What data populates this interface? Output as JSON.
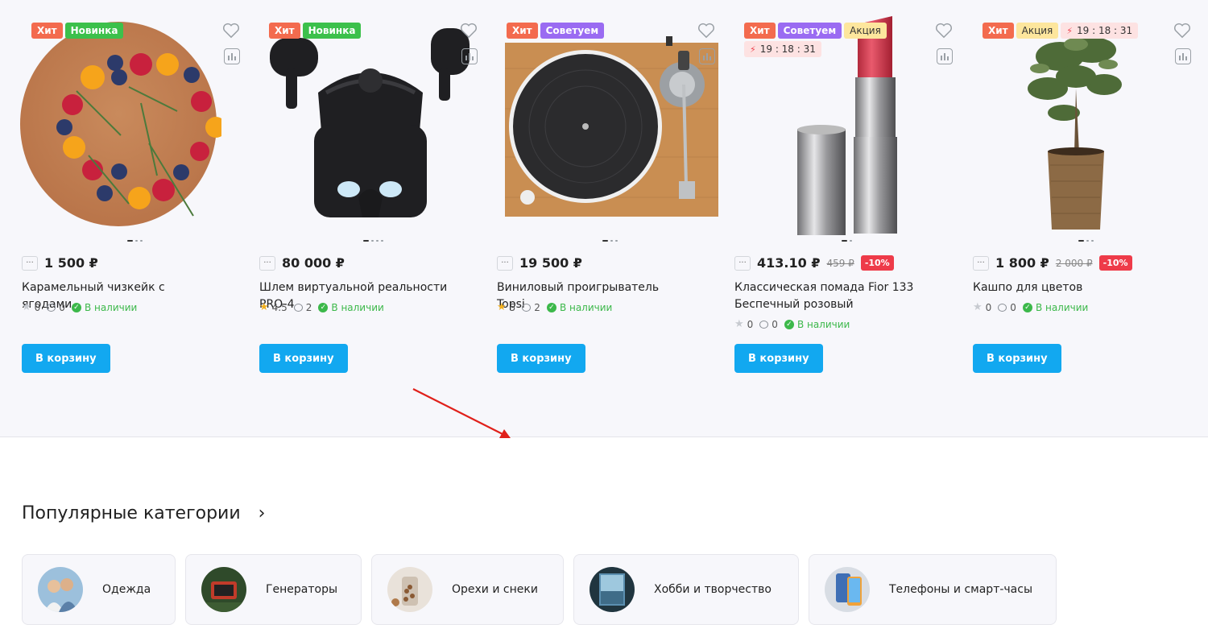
{
  "products": [
    {
      "badges": [
        {
          "type": "hit",
          "text": "Хит"
        },
        {
          "type": "new",
          "text": "Новинка"
        }
      ],
      "price": "1 500 ₽",
      "old_price": "",
      "discount": "",
      "name": "Карамельный чизкейк с ягодами",
      "rating": "0",
      "rated": false,
      "reviews": "0",
      "stock": "В наличии",
      "button": "В корзину",
      "image_icon": "cheesecake-image"
    },
    {
      "badges": [
        {
          "type": "hit",
          "text": "Хит"
        },
        {
          "type": "new",
          "text": "Новинка"
        }
      ],
      "price": "80 000 ₽",
      "old_price": "",
      "discount": "",
      "name": "Шлем виртуальной реальности PRO-4",
      "rating": "4.5",
      "rated": true,
      "reviews": "2",
      "stock": "В наличии",
      "button": "В корзину",
      "image_icon": "vr-headset-image"
    },
    {
      "badges": [
        {
          "type": "hit",
          "text": "Хит"
        },
        {
          "type": "rec",
          "text": "Советуем"
        }
      ],
      "price": "19 500 ₽",
      "old_price": "",
      "discount": "",
      "name": "Виниловый проигрыватель Topsi",
      "rating": "5",
      "rated": true,
      "reviews": "2",
      "stock": "В наличии",
      "button": "В корзину",
      "image_icon": "turntable-image"
    },
    {
      "badges": [
        {
          "type": "hit",
          "text": "Хит"
        },
        {
          "type": "rec",
          "text": "Советуем"
        },
        {
          "type": "promo",
          "text": "Акция"
        },
        {
          "type": "timer",
          "text": "19 : 18 : 31"
        }
      ],
      "price": "413.10 ₽",
      "old_price": "459 ₽",
      "discount": "-10%",
      "name": "Классическая помада Fior 133 Беспечный розовый",
      "rating": "0",
      "rated": false,
      "reviews": "0",
      "stock": "В наличии",
      "button": "В корзину",
      "image_icon": "lipstick-image"
    },
    {
      "badges": [
        {
          "type": "hit",
          "text": "Хит"
        },
        {
          "type": "promo",
          "text": "Акция"
        },
        {
          "type": "timer",
          "text": "19 : 18 : 31"
        }
      ],
      "price": "1 800 ₽",
      "old_price": "2 000 ₽",
      "discount": "-10%",
      "name": "Кашпо для цветов",
      "rating": "0",
      "rated": false,
      "reviews": "0",
      "stock": "В наличии",
      "button": "В корзину",
      "image_icon": "plant-pot-image"
    }
  ],
  "categories_section": {
    "title": "Популярные категории",
    "items": [
      {
        "label": "Одежда",
        "icon": "clothing-thumb"
      },
      {
        "label": "Генераторы",
        "icon": "generator-thumb"
      },
      {
        "label": "Орехи и снеки",
        "icon": "nuts-thumb"
      },
      {
        "label": "Хобби и творчество",
        "icon": "hobby-thumb"
      },
      {
        "label": "Телефоны и смарт-часы",
        "icon": "phones-thumb"
      }
    ]
  },
  "colors": {
    "accent": "#12a8f0",
    "hit": "#f36b4e",
    "new": "#3cc04b",
    "recommend": "#9a6bf2",
    "promo": "#fde69d",
    "discount": "#ee3b49",
    "in_stock": "#3cb84a"
  }
}
